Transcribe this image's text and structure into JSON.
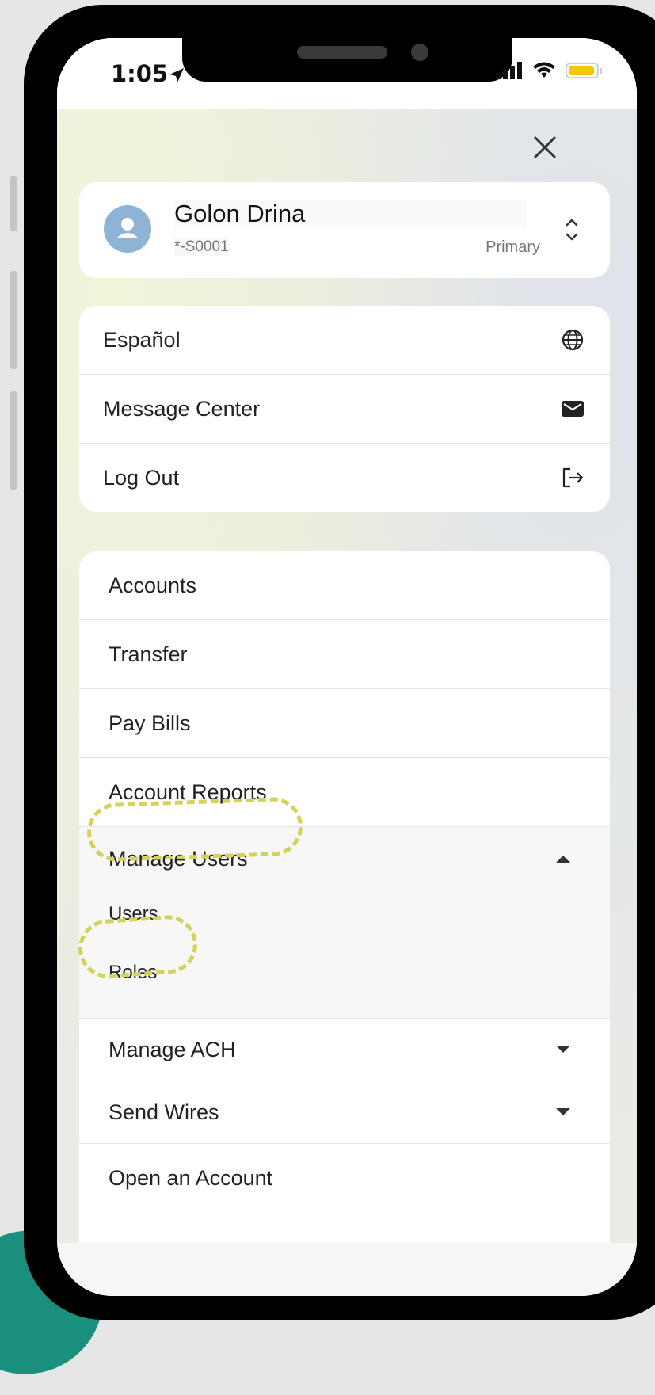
{
  "status_bar": {
    "time": "1:05"
  },
  "profile": {
    "name": "Golon Drina",
    "account_id": "*-S0001",
    "role": "Primary"
  },
  "quick_actions": [
    {
      "label": "Español",
      "icon": "globe-icon"
    },
    {
      "label": "Message Center",
      "icon": "envelope-icon"
    },
    {
      "label": "Log Out",
      "icon": "logout-icon"
    }
  ],
  "menu": {
    "accounts": "Accounts",
    "transfer": "Transfer",
    "pay_bills": "Pay Bills",
    "account_reports": "Account Reports",
    "manage_users": "Manage Users",
    "manage_users_sub": [
      "Users",
      "Roles"
    ],
    "manage_ach": "Manage ACH",
    "send_wires": "Send Wires",
    "open_account": "Open an Account"
  },
  "colors": {
    "highlight": "#d3d35a",
    "avatar": "#8fb3d5",
    "battery": "#f6c800"
  }
}
